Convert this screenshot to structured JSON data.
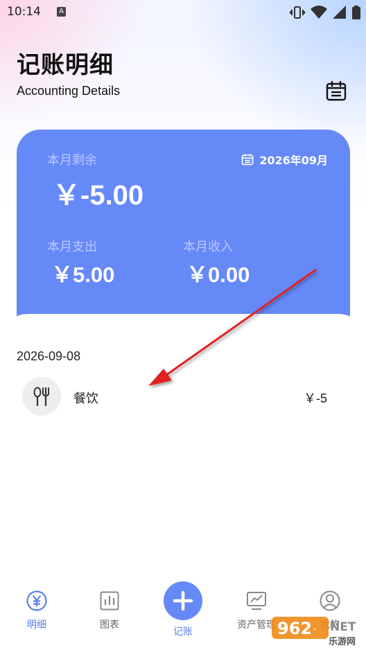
{
  "status_bar": {
    "time": "10:14",
    "a_badge": "A",
    "icons": [
      "vibrate-icon",
      "wifi-icon",
      "signal-icon",
      "battery-icon"
    ]
  },
  "header": {
    "title": "记账明细",
    "subtitle": "Accounting Details"
  },
  "summary": {
    "remaining_label": "本月剩余",
    "remaining_value": "￥-5.00",
    "month": "2026年09月",
    "expense_label": "本月支出",
    "expense_value": "￥5.00",
    "income_label": "本月收入",
    "income_value": "￥0.00"
  },
  "records": {
    "date": "2026-09-08",
    "items": [
      {
        "category": "餐饮",
        "amount": "￥-5",
        "icon": "utensils-icon"
      }
    ]
  },
  "nav": {
    "details": "明细",
    "charts": "图表",
    "add": "记账",
    "assets": "资产管理",
    "mine": "我的"
  },
  "watermark": {
    "brand": "962",
    "suffix": "NET",
    "tagline": "乐游网"
  },
  "colors": {
    "accent": "#6689f8",
    "card_label": "#b9c9ff",
    "annotation_arrow": "#e02020"
  }
}
